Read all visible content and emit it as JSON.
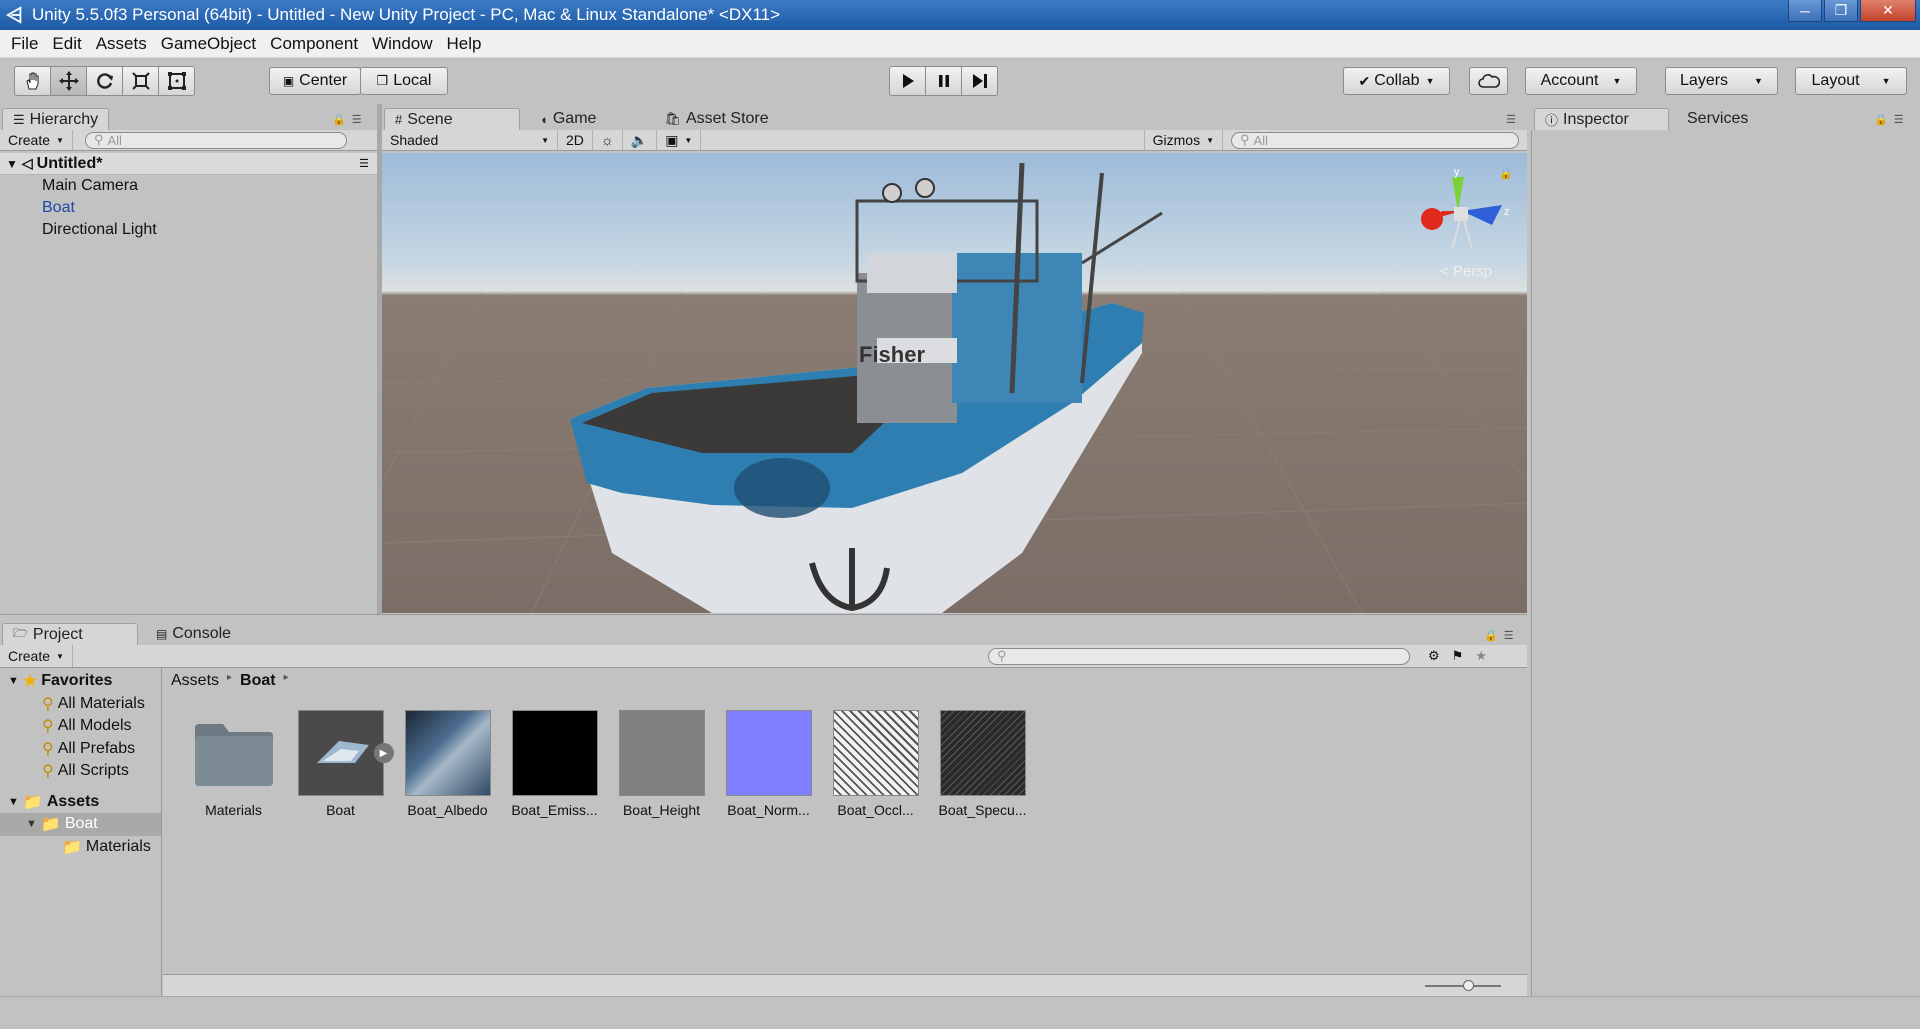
{
  "window": {
    "title": "Unity 5.5.0f3 Personal (64bit) - Untitled - New Unity Project - PC, Mac & Linux Standalone* <DX11>"
  },
  "menu": [
    "File",
    "Edit",
    "Assets",
    "GameObject",
    "Component",
    "Window",
    "Help"
  ],
  "toolbar": {
    "pivot_label": "Center",
    "space_label": "Local",
    "collab_label": "Collab",
    "account_label": "Account",
    "layers_label": "Layers",
    "layout_label": "Layout"
  },
  "hierarchy": {
    "tab_label": "Hierarchy",
    "create_label": "Create",
    "search_placeholder": "All",
    "root": "Untitled*",
    "items": [
      "Main Camera",
      "Boat",
      "Directional Light"
    ],
    "selected": "Boat"
  },
  "scene": {
    "tabs": [
      "Scene",
      "Game",
      "Asset Store"
    ],
    "active_tab": "Scene",
    "shading_mode": "Shaded",
    "mode_2d": "2D",
    "gizmos_label": "Gizmos",
    "search_placeholder": "All",
    "projection_label": "Persp",
    "gizmo_axes": {
      "y": "y",
      "z": "z"
    },
    "hull_text": "Fisher"
  },
  "inspector": {
    "tabs": [
      "Inspector",
      "Services"
    ],
    "active_tab": "Inspector"
  },
  "project": {
    "tabs": [
      "Project",
      "Console"
    ],
    "active_tab": "Project",
    "create_label": "Create",
    "favorites_label": "Favorites",
    "favorites": [
      "All Materials",
      "All Models",
      "All Prefabs",
      "All Scripts"
    ],
    "assets_label": "Assets",
    "assets_tree": [
      "Boat",
      "Materials"
    ],
    "breadcrumb": [
      "Assets",
      "Boat"
    ],
    "assets": [
      {
        "label": "Materials",
        "kind": "folder"
      },
      {
        "label": "Boat",
        "kind": "model"
      },
      {
        "label": "Boat_Albedo",
        "kind": "texture",
        "color": "#3b5a7a"
      },
      {
        "label": "Boat_Emiss...",
        "kind": "texture",
        "color": "#000000"
      },
      {
        "label": "Boat_Height",
        "kind": "texture",
        "color": "#7f7f7f"
      },
      {
        "label": "Boat_Norm...",
        "kind": "texture",
        "color": "#7f7fff"
      },
      {
        "label": "Boat_Occl...",
        "kind": "texture",
        "color": "#e0e0e0"
      },
      {
        "label": "Boat_Specu...",
        "kind": "texture",
        "color": "#3a3a3a"
      }
    ]
  },
  "colors": {
    "title_bar": "#2563ae",
    "selection": "#1f46a8"
  }
}
